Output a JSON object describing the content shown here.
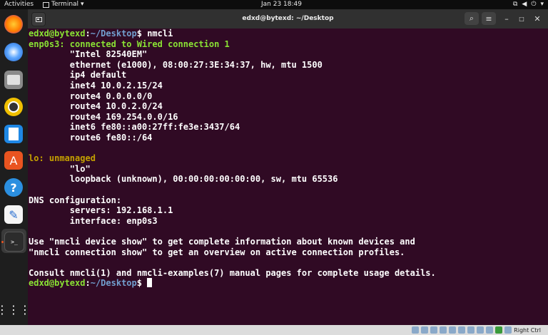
{
  "topbar": {
    "activities": "Activities",
    "app_name": "Terminal",
    "clock": "Jan 23  18:49"
  },
  "window": {
    "title": "edxd@bytexd: ~/Desktop"
  },
  "dock": {
    "icons": [
      "firefox-icon",
      "thunderbird-icon",
      "files-icon",
      "rhythmbox-icon",
      "libreoffice-writer-icon",
      "software-center-icon",
      "help-icon",
      "text-editor-icon",
      "terminal-icon",
      "show-apps-icon"
    ]
  },
  "terminal": {
    "prompt_user": "edxd@bytexd",
    "prompt_sep": ":",
    "prompt_path": "~/Desktop",
    "prompt_dollar": "$ ",
    "command": "nmcli",
    "lines": [
      "enp0s3: connected to Wired connection 1",
      "        \"Intel 82540EM\"",
      "        ethernet (e1000), 08:00:27:3E:34:37, hw, mtu 1500",
      "        ip4 default",
      "        inet4 10.0.2.15/24",
      "        route4 0.0.0.0/0",
      "        route4 10.0.2.0/24",
      "        route4 169.254.0.0/16",
      "        inet6 fe80::a00:27ff:fe3e:3437/64",
      "        route6 fe80::/64",
      "",
      "lo: unmanaged",
      "        \"lo\"",
      "        loopback (unknown), 00:00:00:00:00:00, sw, mtu 65536",
      "",
      "DNS configuration:",
      "        servers: 192.168.1.1",
      "        interface: enp0s3",
      "",
      "Use \"nmcli device show\" to get complete information about known devices and",
      "\"nmcli connection show\" to get an overview on active connection profiles.",
      "",
      "Consult nmcli(1) and nmcli-examples(7) manual pages for complete usage details."
    ],
    "colors": {
      "connected": "#8ae234",
      "unmanaged": "#c4a000",
      "user": "#8ae234",
      "path": "#729fcf",
      "background": "#300a24"
    }
  },
  "statusbar": {
    "host_key": "Right Ctrl"
  }
}
